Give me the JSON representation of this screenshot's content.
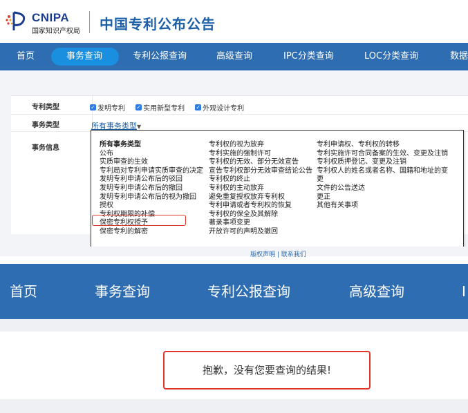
{
  "header": {
    "logo_text": "CNIPA",
    "logo_subtext": "国家知识产权局",
    "site_title": "中国专利公布公告"
  },
  "nav": {
    "items": [
      "首页",
      "事务查询",
      "专利公报查询",
      "高级查询",
      "IPC分类查询",
      "LOC分类查询",
      "数据"
    ],
    "active": "事务查询"
  },
  "form": {
    "patent_type": {
      "label": "专利类型",
      "options": [
        "发明专利",
        "实用新型专利",
        "外观设计专利"
      ]
    },
    "transaction_type": {
      "label": "事务类型",
      "selected": "所有事务类型"
    },
    "transaction_info": {
      "label": "事务信息"
    }
  },
  "dropdown": {
    "col1": [
      "所有事务类型",
      "公布",
      "实质审查的生效",
      "专利局对专利申请实质审查的决定",
      "发明专利申请公布后的驳回",
      "发明专利申请公布后的撤回",
      "发明专利申请公布后的视为撤回",
      "授权",
      "专利权期限的补偿",
      "保密专利权授予",
      "保密专利的解密"
    ],
    "col2": [
      "专利权的视为放弃",
      "专利实施的强制许可",
      "专利权的无效、部分无效宣告",
      "宣告专利权部分无效审查结论公告",
      "专利权的终止",
      "专利权的主动放弃",
      "避免重复授权放弃专利权",
      "专利申请或者专利权的恢复",
      "专利权的保全及其解除",
      "著录事项变更",
      "开放许可的声明及撤回"
    ],
    "col3": [
      "专利申请权、专利权的转移",
      "专利实施许可合同备案的生效、变更及注销",
      "专利权质押登记、变更及注销",
      "专利权人的姓名或者名称、国籍和地址的变",
      "更",
      "文件的公告送达",
      "更正",
      "其他有关事项"
    ],
    "highlighted": "专利权期限的补偿"
  },
  "footer_peek": "版权声明 | 联系我们",
  "big_nav": {
    "items": [
      "首页",
      "事务查询",
      "专利公报查询",
      "高级查询",
      "I"
    ]
  },
  "result": {
    "message": "抱歉，没有您要查询的结果!"
  },
  "colors": {
    "nav_bg": "#2e6db1",
    "nav_active": "#1a8fe0",
    "highlight_border": "#e0352b",
    "title": "#1b5fa8"
  }
}
